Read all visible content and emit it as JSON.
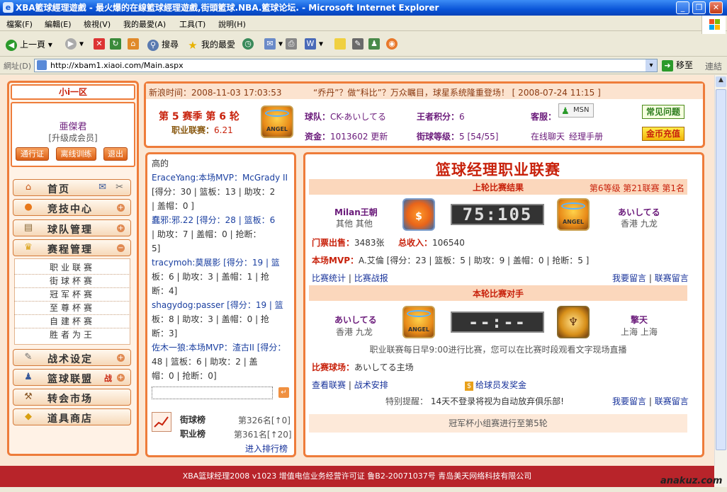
{
  "window": {
    "title": "XBA籃球經理遊戲 - 最火爆的在線籃球經理遊戲,街頭籃球.NBA.籃球论坛. - Microsoft Internet Explorer"
  },
  "menu": [
    "檔案(F)",
    "編輯(E)",
    "檢視(V)",
    "我的最愛(A)",
    "工具(T)",
    "說明(H)"
  ],
  "toolbar": {
    "back": "上一頁",
    "search": "搜尋",
    "favorites": "我的最愛"
  },
  "address": {
    "label": "網址(D)",
    "url": "http://xbam1.xiaoi.com/Main.aspx",
    "go": "移至",
    "links": "連結"
  },
  "sidebar": {
    "region": "小i一区",
    "username": "亜傑君",
    "member": "[升级成会员]",
    "buttons": [
      "通行证",
      "离线训练",
      "退出"
    ],
    "nav": [
      {
        "label": "首页",
        "icon": "home-icon"
      },
      {
        "label": "竞技中心",
        "icon": "basketball-icon"
      },
      {
        "label": "球队管理",
        "icon": "clipboard-icon"
      },
      {
        "label": "赛程管理",
        "icon": "trophy-icon"
      },
      {
        "label": "战术设定",
        "icon": "tactics-icon"
      },
      {
        "label": "篮球联盟",
        "icon": "people-icon",
        "badge": "战"
      },
      {
        "label": "转会市场",
        "icon": "hammer-icon"
      },
      {
        "label": "道具商店",
        "icon": "shop-icon"
      }
    ],
    "sub": [
      "职业联赛",
      "街球杯赛",
      "冠军杯赛",
      "至尊杯赛",
      "自建杯赛",
      "胜者为王"
    ]
  },
  "header": {
    "news_time_label": "新浪时间：",
    "news_time": "2008-11-03 17:03:53",
    "ticker": "“乔丹”？做“科比”？万众瞩目，球星系统隆重登场！ [ 2008-07-24 11:15 ]",
    "season": "第 5 赛季 第 6 轮",
    "league_points_label": "职业联赛：",
    "league_points": "6.21",
    "team_label": "球队：",
    "team": "CK-あいしてる",
    "king_label": "王者积分：",
    "king": "6",
    "fund_label": "资金：",
    "fund": "1013602",
    "update": "更新",
    "street_label": "街球等级：",
    "street": "5 [54/55]",
    "service": "客服：",
    "msn": "MSN",
    "chat": "在线聊天",
    "manual": "经理手册",
    "faq": "常见问题",
    "recharge": "金币充值"
  },
  "feed": {
    "title": "高的",
    "lines": [
      "EraceYang:本场MVP：McGrady II",
      "[得分：30 | 篮板：13 | 助攻：2",
      "| 盖帽：0 ]",
      "蠢邪:邪.22 [得分：28 | 篮板：6",
      "| 助攻：7 | 盖帽：0 | 抢断：",
      "5]",
      "tracymoh:莫展影 [得分：19 | 篮",
      "板：6 | 助攻：3 | 盖帽：1 | 抢",
      "断：4]",
      "shagydog:passer [得分：19 | 篮",
      "板：8 | 助攻：3 | 盖帽：0 | 抢",
      "断：3]",
      "佐木一狼:本场MVP：渣古II [得分：",
      "48 | 篮板：6 | 助攻：2 | 盖",
      "帽：0 | 抢断：0]"
    ],
    "rank1_label": "街球榜",
    "rank1": "第326名[↑0]",
    "rank2_label": "职业榜",
    "rank2": "第361名[↑20]",
    "enter_rank": "进入排行榜"
  },
  "main": {
    "title": "篮球经理职业联赛",
    "last_title": "上轮比赛结果",
    "level": "第6等级  第21联赛  第1名",
    "home_team": "Milan王朝",
    "home_loc": "其他 其他",
    "score": "75:105",
    "away_team": "あいしてる",
    "away_loc": "香港 九龙",
    "tickets_label": "门票出售：",
    "tickets": "3483张",
    "income_label": "总收入：",
    "income": "106540",
    "mvp_label": "本场MVP：",
    "mvp": "A.艾倫 [得分：23 | 篮板：5 | 助攻：9 | 盖帽：0 | 抢断：5 ]",
    "stats_link": "比赛统计",
    "report_link": "比赛战报",
    "msg_link1": "我要留言",
    "msg_link2": "联赛留言",
    "next_title": "本轮比赛对手",
    "next_home": "あいしてる",
    "next_home_loc": "香港 九龙",
    "next_score": "--:--",
    "next_away": "擎天",
    "next_away_loc": "上海 上海",
    "notice": "职业联赛每日早9:00进行比赛，您可以在比赛时段观看文字现场直播",
    "court_label": "比赛球场：",
    "court": "あいしてる主场",
    "view_league": "查看联赛",
    "tactics": "战术安排",
    "bonus": "给球员发奖金",
    "remind_label": "特别提醒：",
    "remind": "14天不登录将视为自动放弃俱乐部!",
    "cup": "冠军杯小组赛进行至第5轮"
  },
  "footer": "XBA篮球经理2008 v1023   增值电信业务经营许可证  鲁B2-20071037号  青岛美天网络科技有限公司",
  "watermark": "anakuz.com"
}
